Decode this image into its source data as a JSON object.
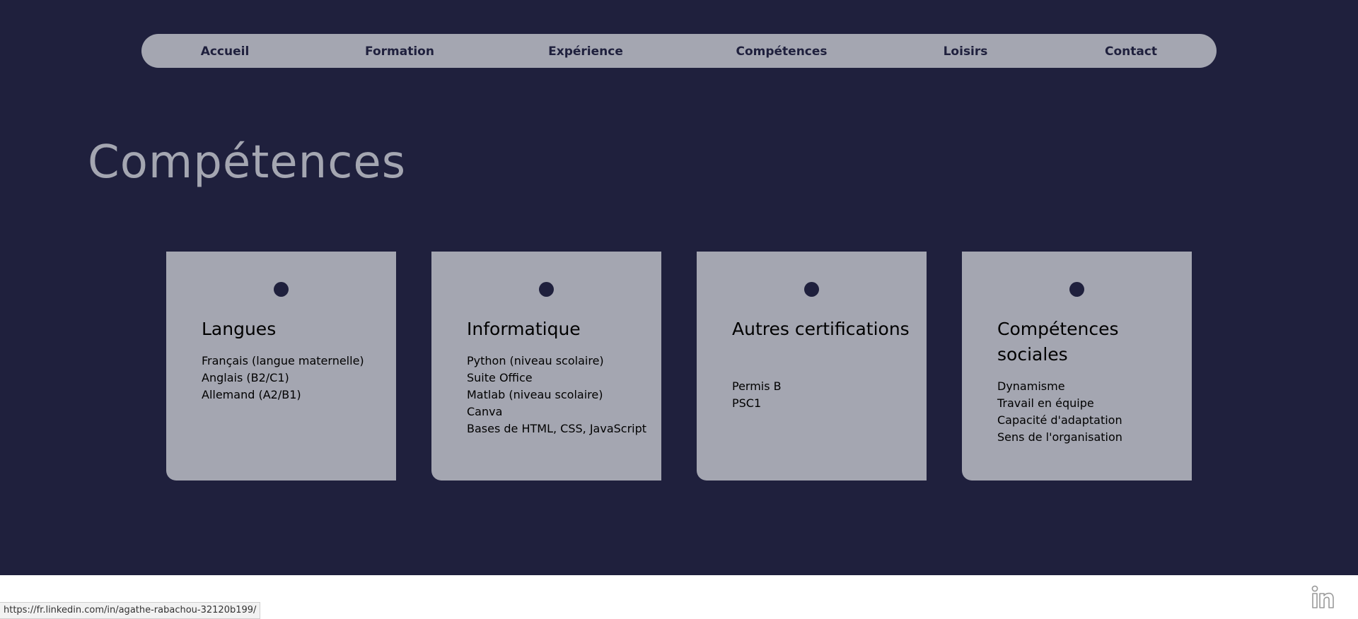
{
  "nav": {
    "items": [
      {
        "label": "Accueil"
      },
      {
        "label": "Formation"
      },
      {
        "label": "Expérience"
      },
      {
        "label": "Compétences"
      },
      {
        "label": "Loisirs"
      },
      {
        "label": "Contact"
      }
    ]
  },
  "page": {
    "title": "Compétences"
  },
  "cards": [
    {
      "title": "Langues",
      "items": [
        "Français (langue maternelle)",
        "Anglais (B2/C1)",
        "Allemand (A2/B1)"
      ]
    },
    {
      "title": "Informatique",
      "items": [
        "Python (niveau scolaire)",
        "Suite Office",
        "Matlab (niveau scolaire)",
        "Canva",
        "Bases de HTML, CSS, JavaScript"
      ]
    },
    {
      "title": "Autres certifications",
      "items": [
        "Permis B",
        "PSC1"
      ]
    },
    {
      "title": "Compétences sociales",
      "items": [
        "Dynamisme",
        "Travail en équipe",
        "Capacité d'adaptation",
        "Sens de l'organisation"
      ]
    }
  ],
  "status_bar": {
    "url": "https://fr.linkedin.com/in/agathe-rabachou-32120b199/"
  },
  "icons": {
    "linkedin": "linkedin-icon"
  },
  "colors": {
    "background": "#1f203d",
    "panel": "#a4a6b1",
    "footer": "#ffffff"
  }
}
